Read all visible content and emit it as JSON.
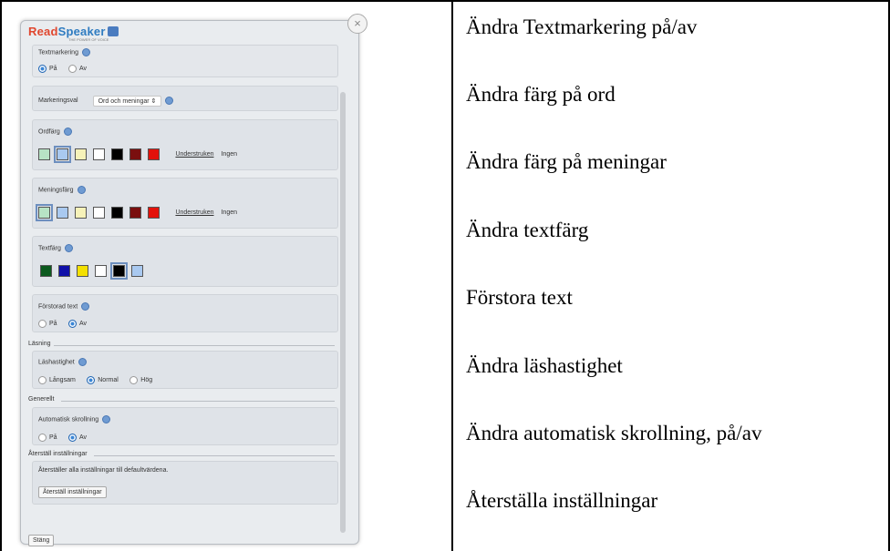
{
  "panel": {
    "logo": {
      "read": "Read",
      "speaker": "Speaker",
      "tagline": "THE POWER OF VOICE"
    },
    "close_glyph": "×",
    "textmarkering": {
      "label": "Textmarkering",
      "options": [
        "På",
        "Av"
      ],
      "selected": "På"
    },
    "markeringsval": {
      "label": "Markeringsval",
      "value": "Ord och meningar ⇕"
    },
    "ordfarg": {
      "label": "Ordfärg",
      "swatches": [
        "#b7e3c5",
        "#a9c9f0",
        "#f6f2b9",
        "#ffffff",
        "#000000",
        "#7a0f0f",
        "#e3120b"
      ],
      "selected_index": 1,
      "underline_label": "Understruken",
      "none_label": "Ingen"
    },
    "meningsfarg": {
      "label": "Meningsfärg",
      "swatches": [
        "#b7e3c5",
        "#a9c9f0",
        "#f6f2b9",
        "#ffffff",
        "#000000",
        "#7a0f0f",
        "#e3120b"
      ],
      "selected_index": 0,
      "underline_label": "Understruken",
      "none_label": "Ingen"
    },
    "textfarg": {
      "label": "Textfärg",
      "swatches": [
        "#0c5a1e",
        "#1010a8",
        "#f3e000",
        "#ffffff",
        "#000000",
        "#a9c9f0"
      ],
      "selected_index": 4
    },
    "forstorad": {
      "label": "Förstorad text",
      "options": [
        "På",
        "Av"
      ],
      "selected": "Av"
    },
    "lasning_group": "Läsning",
    "lashastighet": {
      "label": "Läshastighet",
      "options": [
        "Långsam",
        "Normal",
        "Hög"
      ],
      "selected": "Normal"
    },
    "generellt_group": "Generellt",
    "autoscroll": {
      "label": "Automatisk skrollning",
      "options": [
        "På",
        "Av"
      ],
      "selected": "Av"
    },
    "aterstall_group": "Återställ inställningar",
    "aterstall_desc": "Återställer alla inställningar till defaultvärdena.",
    "aterstall_button": "Återställ inställningar",
    "close_button": "Stäng"
  },
  "descriptions": [
    "Ändra Textmarkering på/av",
    "Ändra färg på ord",
    "Ändra färg på meningar",
    "Ändra textfärg",
    "Förstora text",
    "Ändra läshastighet",
    "Ändra automatisk skrollning, på/av",
    "Återställa inställningar"
  ]
}
